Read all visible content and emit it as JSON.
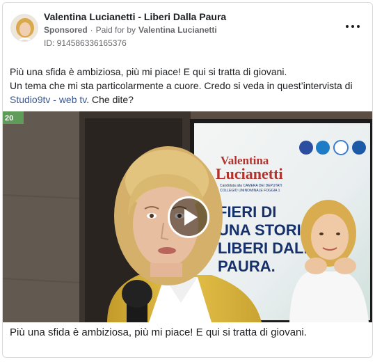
{
  "post": {
    "page_name": "Valentina Lucianetti - Liberi Dalla Paura",
    "sponsored_label": "Sponsored",
    "paid_for_by_label": "Paid for by",
    "paid_for_by_name": "Valentina Lucianetti",
    "ad_id": "ID: 914586336165376",
    "more_icon": "more-horizontal-icon",
    "avatar_icon": "profile-avatar"
  },
  "body": {
    "line1": "Più una sfida è ambiziosa, più mi piace! E qui si tratta di giovani.",
    "line2": "Un tema che mi sta particolarmente a cuore. Credo si veda in quest’intervista di",
    "link_text": "Studio9tv - web tv",
    "line3_rest": ". Che dite?"
  },
  "video": {
    "poster": {
      "first_name": "Valentina",
      "last_name": "Lucianetti",
      "subtitle_line1": "Candidata alla CAMERA DEI DEPUTATI",
      "subtitle_line2": "COLLEGIO UNINOMINALE FOGGIA 1",
      "slogan_line1": "FIERI DI",
      "slogan_line2": "UNA STORIA.",
      "slogan_line3": "LIBERI DALLA",
      "slogan_line4": "PAURA.",
      "sign_number": "20"
    },
    "play_icon": "play-icon"
  },
  "caption": "Più una sfida è ambiziosa, più mi piace! E qui si tratta di giovani.",
  "colors": {
    "link": "#385898",
    "secondary_text": "#65676b",
    "poster_red": "#b5322c",
    "poster_blue": "#16306b",
    "poster_green": "#3e8a4b",
    "blazer_yellow": "#d9b53b"
  }
}
